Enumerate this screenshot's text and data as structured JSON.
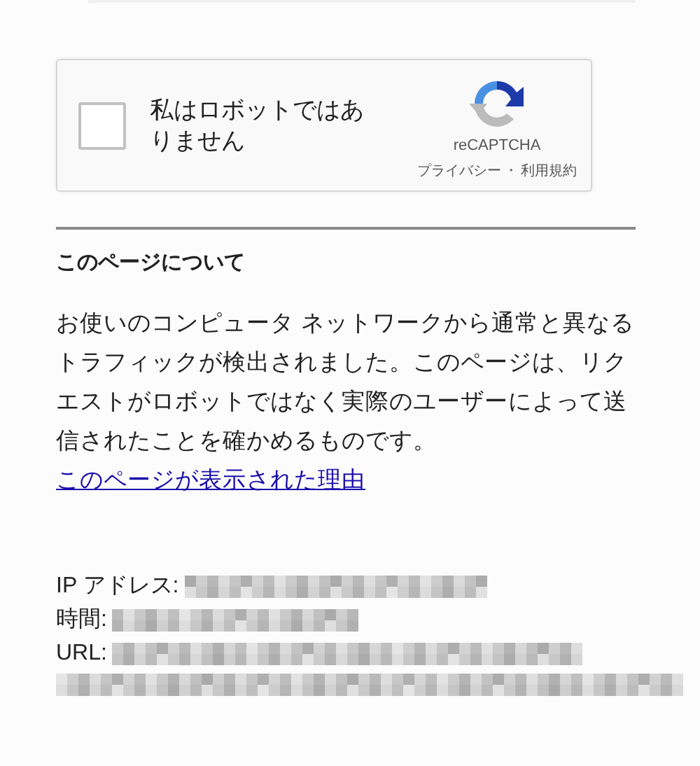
{
  "captcha": {
    "checked": false,
    "label": "私はロボットではありません",
    "brand": "reCAPTCHA",
    "privacy_link": "プライバシー",
    "separator": "・",
    "terms_link": "利用規約"
  },
  "about": {
    "heading": "このページについて",
    "body": "お使いのコンピュータ ネットワークから通常と異なるトラフィックが検出されました。このページは、リクエストがロボットではなく実際のユーザーによって送信されたことを確かめるものです。",
    "link": "このページが表示された理由"
  },
  "info": [
    {
      "label": "IP アドレス:"
    },
    {
      "label": "時間:"
    },
    {
      "label": "URL:"
    }
  ]
}
